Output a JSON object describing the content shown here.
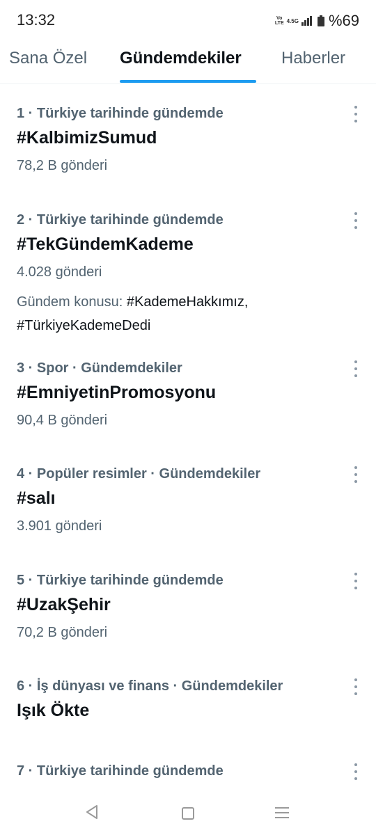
{
  "status_bar": {
    "time": "13:32",
    "volte_top": "Vo",
    "volte_bottom": "LTE",
    "network": "4.5G",
    "battery_percent": "%69"
  },
  "tabs": [
    {
      "label": "Sana Özel"
    },
    {
      "label": "Gündemdekiler"
    },
    {
      "label": "Haberler"
    }
  ],
  "active_tab": "Gündemdekiler",
  "trends": [
    {
      "meta": "1 · Türkiye tarihinde gündemde",
      "title": "#KalbimizSumud",
      "count": "78,2 B gönderi"
    },
    {
      "meta": "2 · Türkiye tarihinde gündemde",
      "title": "#TekGündemKademe",
      "count": "4.028 gönderi",
      "topic_label": "Gündem konusu:",
      "topic_line1": " #KademeHakkımız,",
      "topic_line2": "#TürkiyeKademeDedi"
    },
    {
      "meta": "3 · Spor · Gündemdekiler",
      "title": "#EmniyetinPromosyonu",
      "count": "90,4 B gönderi"
    },
    {
      "meta": "4 · Popüler resimler · Gündemdekiler",
      "title": "#salı",
      "count": "3.901 gönderi"
    },
    {
      "meta": "5 · Türkiye tarihinde gündemde",
      "title": "#UzakŞehir",
      "count": "70,2 B gönderi"
    },
    {
      "meta": "6 · İş dünyası ve finans · Gündemdekiler",
      "title": "Işık Ökte"
    },
    {
      "meta": "7 · Türkiye tarihinde gündemde"
    }
  ],
  "colors": {
    "accent": "#1d9bf0",
    "text_primary": "#0f1419",
    "text_secondary": "#536471"
  },
  "icons": [
    "more-icon",
    "back-icon",
    "home-icon",
    "recents-icon",
    "signal-icon",
    "battery-icon"
  ]
}
